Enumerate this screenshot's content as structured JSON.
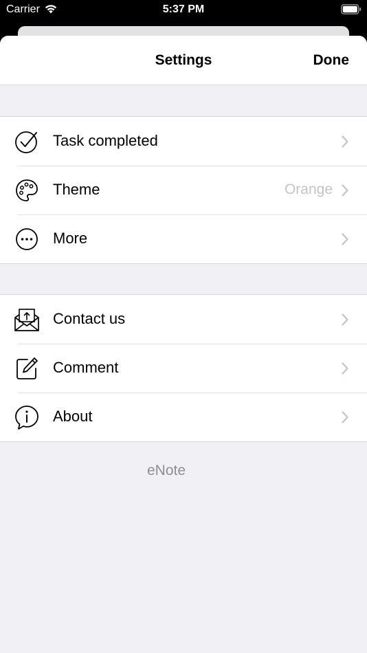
{
  "status_bar": {
    "carrier": "Carrier",
    "time": "5:37 PM"
  },
  "nav": {
    "title": "Settings",
    "done_label": "Done"
  },
  "groups": [
    {
      "items": [
        {
          "label": "Task completed",
          "value": "",
          "icon": "checkmark-circle-icon"
        },
        {
          "label": "Theme",
          "value": "Orange",
          "icon": "palette-icon"
        },
        {
          "label": "More",
          "value": "",
          "icon": "ellipsis-circle-icon"
        }
      ]
    },
    {
      "items": [
        {
          "label": "Contact us",
          "value": "",
          "icon": "envelope-open-icon"
        },
        {
          "label": "Comment",
          "value": "",
          "icon": "square-pencil-icon"
        },
        {
          "label": "About",
          "value": "",
          "icon": "info-bubble-icon"
        }
      ]
    }
  ],
  "footer": {
    "text": "eNote"
  },
  "colors": {
    "background": "#f0f0f5",
    "value_text": "#c4c4c8",
    "footer_text": "#8e8e93"
  }
}
